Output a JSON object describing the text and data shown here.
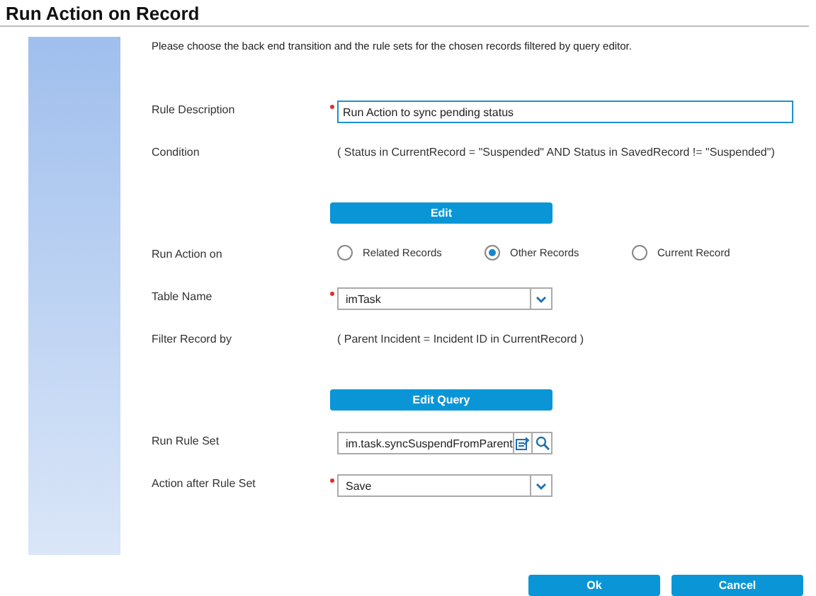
{
  "title": "Run Action on Record",
  "intro": "Please choose the back end transition and the rule sets for the chosen records filtered by query editor.",
  "fields": [
    {
      "kind": "text",
      "label": "Rule Description",
      "required": true,
      "value": "Run Action to sync pending status"
    },
    {
      "kind": "static",
      "label": "Condition",
      "value": "( Status in CurrentRecord = \"Suspended\" AND Status in SavedRecord != \"Suspended\")"
    },
    {
      "kind": "button",
      "label": "Edit"
    },
    {
      "kind": "radio",
      "label": "Run Action on",
      "options": [
        {
          "label": "Related Records",
          "selected": false
        },
        {
          "label": "Other Records",
          "selected": true
        },
        {
          "label": "Current Record",
          "selected": false
        }
      ]
    },
    {
      "kind": "select",
      "label": "Table Name",
      "required": true,
      "value": "imTask"
    },
    {
      "kind": "static",
      "label": "Filter Record by",
      "value": "( Parent Incident = Incident ID in CurrentRecord )"
    },
    {
      "kind": "button",
      "label": "Edit Query"
    },
    {
      "kind": "lookup",
      "label": "Run Rule Set",
      "value": "im.task.syncSuspendFromParent"
    },
    {
      "kind": "select",
      "label": "Action after Rule Set",
      "required": true,
      "value": "Save"
    }
  ],
  "buttons": [
    "Ok",
    "Cancel"
  ]
}
